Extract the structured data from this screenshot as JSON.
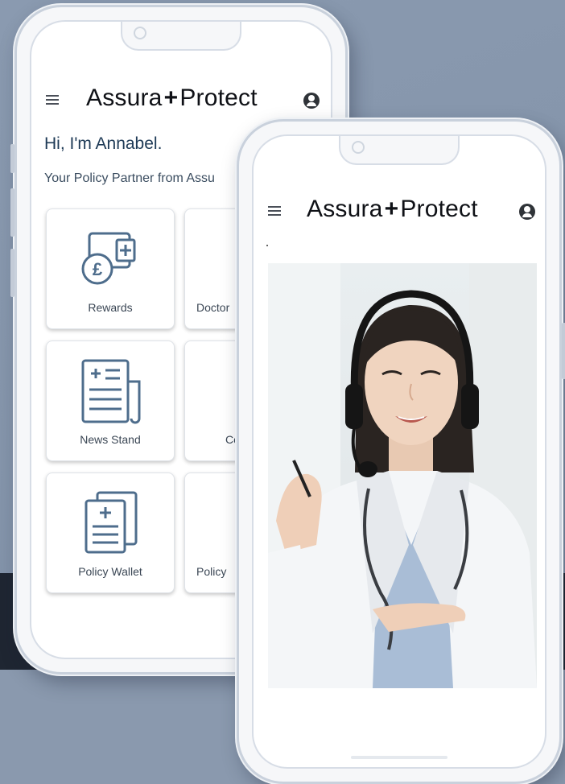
{
  "left_phone": {
    "brand": {
      "name_a": "Assura",
      "plus": "+",
      "name_b": "Protect"
    },
    "greeting": "Hi, I'm Annabel.",
    "subtitle": "Your Policy Partner from Assu",
    "tiles": [
      {
        "label": "Rewards",
        "icon": "rewards-icon"
      },
      {
        "label": "Doctor",
        "icon": "doctor-icon"
      },
      {
        "label": "News Stand",
        "icon": "news-stand-icon"
      },
      {
        "label": "Co",
        "icon": "contact-icon"
      },
      {
        "label": "Policy Wallet",
        "icon": "policy-wallet-icon"
      },
      {
        "label": "Policy",
        "icon": "policy-icon"
      }
    ]
  },
  "right_phone": {
    "brand": {
      "name_a": "Assura",
      "plus": "+",
      "name_b": "Protect"
    },
    "video": {
      "subject": "doctor-with-headset"
    }
  },
  "colors": {
    "icon_stroke": "#4e6d8c",
    "brand_text": "#0f1116",
    "greeting": "#1e3a56",
    "dark_band": "#1f2632"
  }
}
